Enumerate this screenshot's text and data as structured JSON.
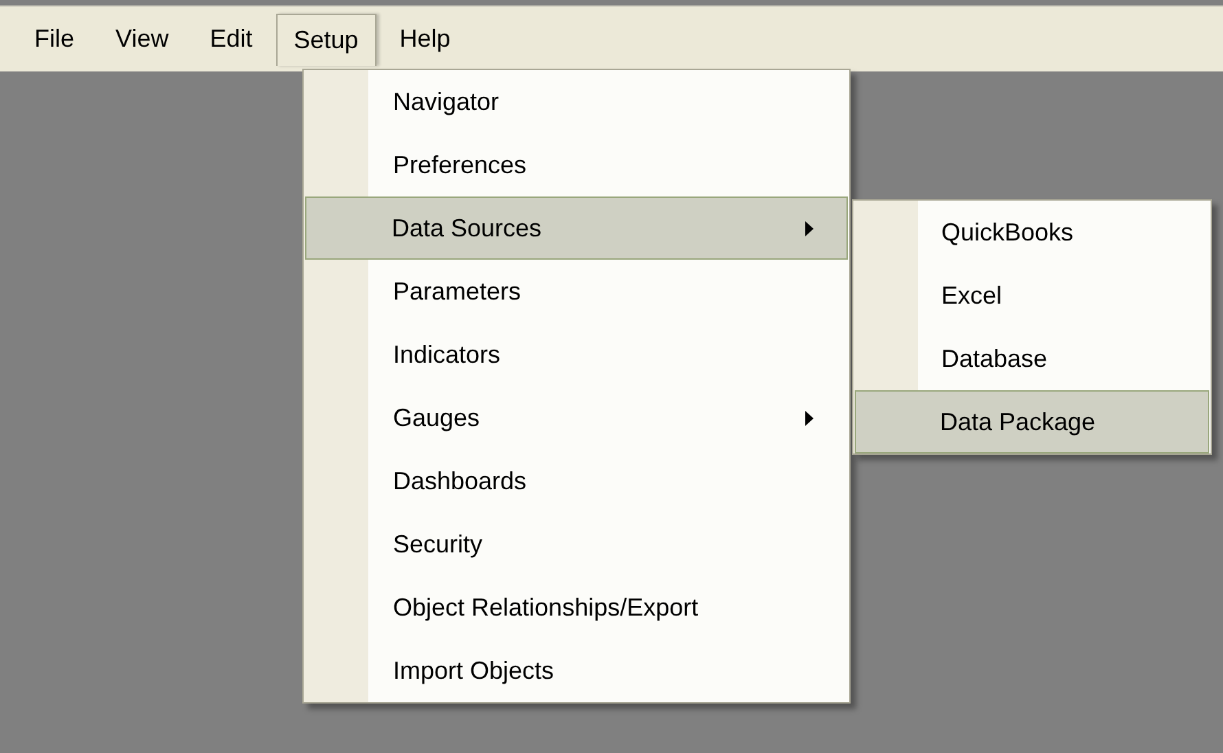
{
  "menu_bar": [
    {
      "label": "File",
      "selected": false
    },
    {
      "label": "View",
      "selected": false
    },
    {
      "label": "Edit",
      "selected": false
    },
    {
      "label": "Setup",
      "selected": true
    },
    {
      "label": "Help",
      "selected": false
    }
  ],
  "dropdown": {
    "items": [
      {
        "label": "Navigator",
        "selected": false,
        "has_submenu": false
      },
      {
        "label": "Preferences",
        "selected": false,
        "has_submenu": false
      },
      {
        "label": "Data Sources",
        "selected": true,
        "has_submenu": true
      },
      {
        "label": "Parameters",
        "selected": false,
        "has_submenu": false
      },
      {
        "label": "Indicators",
        "selected": false,
        "has_submenu": false
      },
      {
        "label": "Gauges",
        "selected": false,
        "has_submenu": true
      },
      {
        "label": "Dashboards",
        "selected": false,
        "has_submenu": false
      },
      {
        "label": "Security",
        "selected": false,
        "has_submenu": false
      },
      {
        "label": "Object Relationships/Export",
        "selected": false,
        "has_submenu": false
      },
      {
        "label": "Import Objects",
        "selected": false,
        "has_submenu": false
      }
    ]
  },
  "submenu": {
    "items": [
      {
        "label": "QuickBooks",
        "selected": false
      },
      {
        "label": "Excel",
        "selected": false
      },
      {
        "label": "Database",
        "selected": false
      },
      {
        "label": "Data Package",
        "selected": true
      }
    ]
  }
}
